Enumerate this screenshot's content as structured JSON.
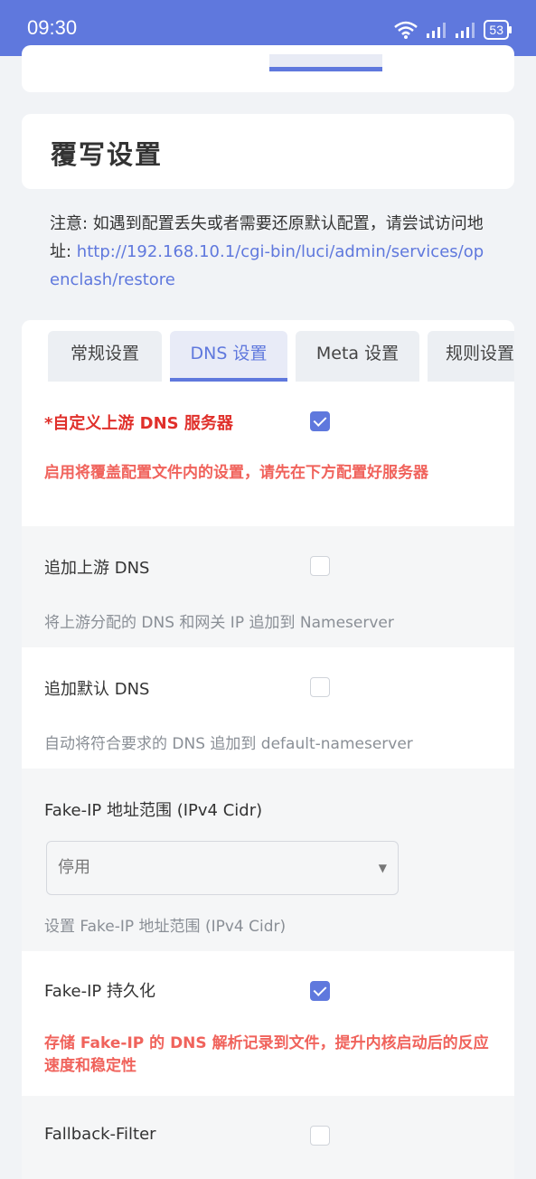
{
  "status": {
    "time": "09:30",
    "battery": "53"
  },
  "page": {
    "title": "覆写设置",
    "notice_prefix": "注意: 如遇到配置丢失或者需要还原默认配置，请尝试访问地址: ",
    "notice_link": "http://192.168.10.1/cgi-bin/luci/admin/services/openclash/restore"
  },
  "tabs": [
    {
      "label": "常规设置"
    },
    {
      "label": "DNS 设置"
    },
    {
      "label": "Meta 设置"
    },
    {
      "label": "规则设置"
    }
  ],
  "settings": {
    "custom_dns": {
      "label": "*自定义上游 DNS 服务器",
      "checked": true,
      "desc": "启用将覆盖配置文件内的设置，请先在下方配置好服务器"
    },
    "append_upstream": {
      "label": "追加上游 DNS",
      "checked": false,
      "desc": "将上游分配的 DNS 和网关 IP 追加到 Nameserver"
    },
    "append_default": {
      "label": "追加默认 DNS",
      "checked": false,
      "desc": "自动将符合要求的 DNS 追加到 default-nameserver"
    },
    "fakeip_range": {
      "label": "Fake-IP 地址范围 (IPv4 Cidr)",
      "value": "停用",
      "desc": "设置 Fake-IP 地址范围 (IPv4 Cidr)"
    },
    "fakeip_persist": {
      "label": "Fake-IP 持久化",
      "checked": true,
      "desc": "存储 Fake-IP 的 DNS 解析记录到文件，提升内核启动后的反应速度和稳定性"
    },
    "fallback_filter": {
      "label": "Fallback-Filter",
      "checked": false
    }
  }
}
